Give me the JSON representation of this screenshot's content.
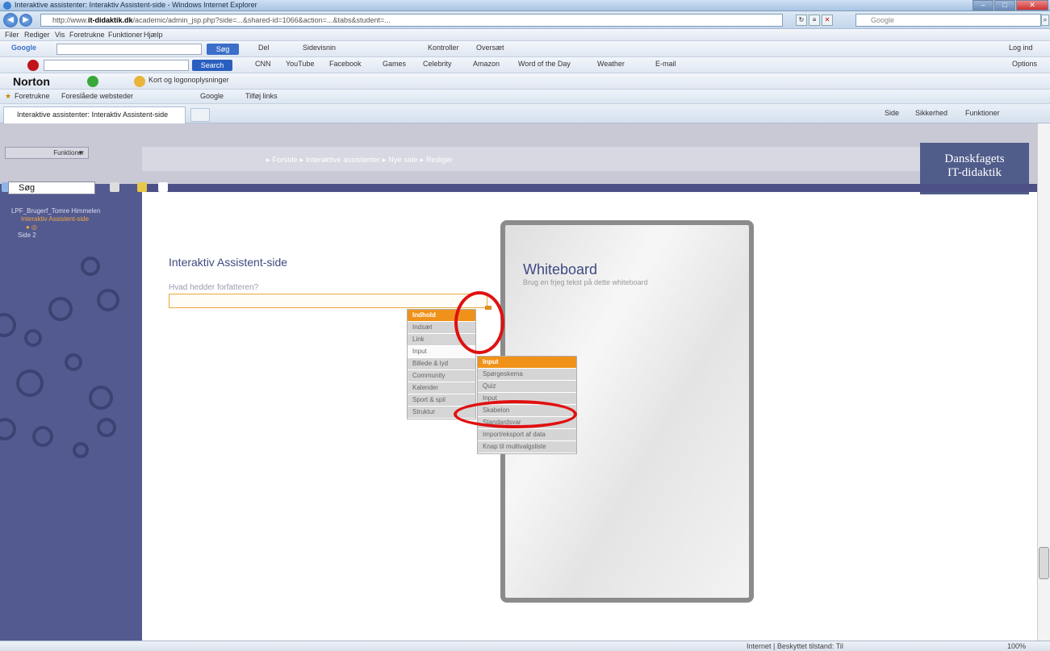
{
  "window": {
    "title": "Interaktive assistenter: Interaktiv Assistent-side - Windows Internet Explorer"
  },
  "address": {
    "url_prefix": "http://www.",
    "url_domain": "it-didaktik.dk",
    "url_rest": "/academic/admin_jsp.php?side=...&shared-id=1066&action=...&tabs&student=...",
    "search_engine": "Google"
  },
  "menubar": {
    "items": [
      "Filer",
      "Rediger",
      "Vis",
      "Foretrukne",
      "Funktioner",
      "Hjælp"
    ]
  },
  "google_bar": {
    "label": "Google",
    "search_btn": "Søg",
    "items": [
      "Del",
      "Sidevisnin",
      "Kontroller",
      "Oversæt"
    ],
    "signin": "Log ind"
  },
  "yahoo_bar": {
    "search_btn": "Search",
    "items": [
      "CNN",
      "YouTube",
      "Facebook",
      "Games",
      "Celebrity",
      "Amazon",
      "Word of the Day",
      "Weather",
      "E-mail"
    ],
    "options": "Options"
  },
  "norton_bar": {
    "brand": "Norton",
    "item": "Kort og logonoplysninger"
  },
  "favorites_bar": {
    "favorites": "Foretrukne",
    "suggested": "Foreslåede websteder",
    "google": "Google",
    "webslice": "Tilføj links"
  },
  "tab": {
    "title": "Interaktive assistenter: Interaktiv Assistent-side"
  },
  "command_bar": {
    "items": [
      "Side",
      "Sikkerhed",
      "Funktioner"
    ]
  },
  "site": {
    "funktioner_dd": "Funktioner",
    "nav": "▸ Forside ▸ Interaktive assistenter ▸ Nye side ▸ Redigér",
    "brand_line1": "Danskfagets",
    "brand_line2": "IT-didaktik",
    "sidebar_search": "Søg",
    "tree": [
      "LPF_Brugerf_Tomre Himmelen",
      "Interaktiv Assistent-side",
      "Side 2"
    ]
  },
  "content": {
    "heading": "Interaktiv Assistent-side",
    "question_label": "Hvad hedder forfatteren?",
    "whiteboard_title": "Whiteboard",
    "whiteboard_sub": "Brug en frjeg tekst på dette whiteboard"
  },
  "menu1": {
    "header": "Indhold",
    "items": [
      "Indsæt",
      "Link",
      "Input",
      "Billede & lyd",
      "Community",
      "Kalender",
      "Sport & spil",
      "Struktur"
    ],
    "highlight_index": 2
  },
  "menu2": {
    "header": "Input",
    "items": [
      "Spørgeskema",
      "Quiz",
      "Input",
      "Skabelon",
      "Standardsvar",
      "Import/eksport af data",
      "Knap til multivalgsliste"
    ]
  },
  "statusbar": {
    "zone": "Internet | Beskyttet tilstand: Til",
    "zoom": "100%"
  }
}
